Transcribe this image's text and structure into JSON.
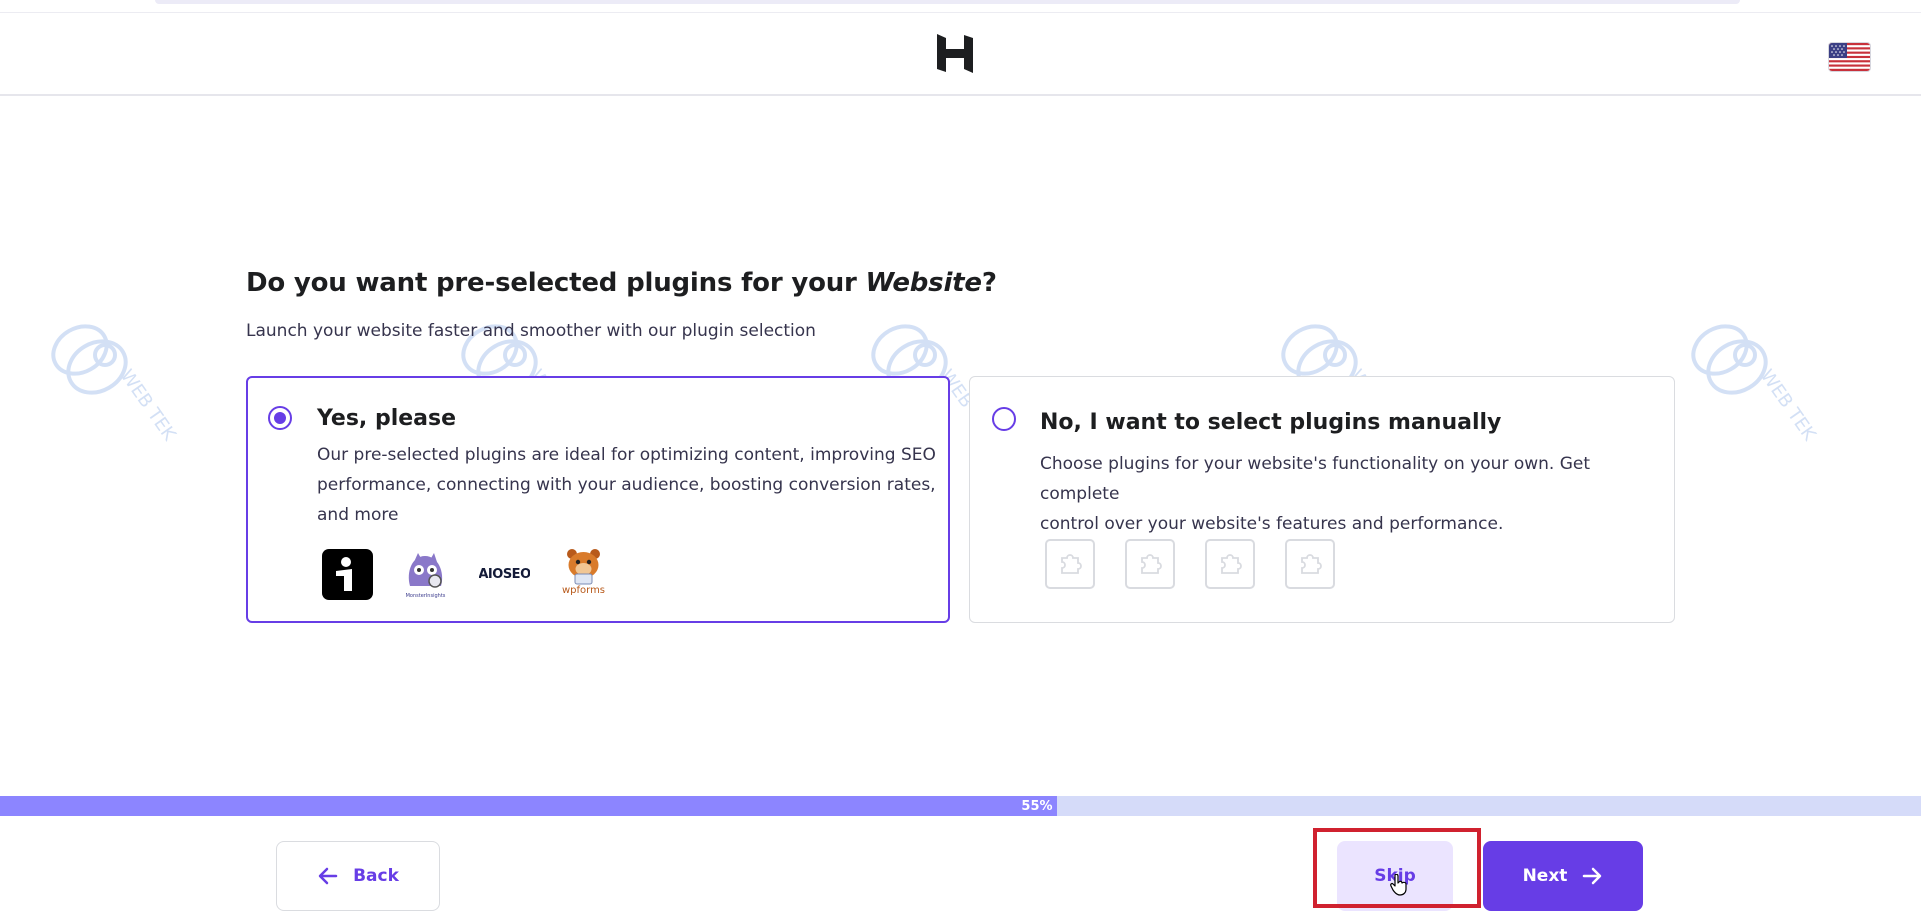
{
  "header": {
    "logo_icon": "hostinger-logo-icon",
    "language_flag_icon": "us-flag-icon"
  },
  "watermark": {
    "text": "WEB TEK"
  },
  "question": {
    "prefix": "Do you want pre-selected plugins for your ",
    "emphasis": "Website",
    "suffix": "?"
  },
  "subtitle": "Launch your website faster and smoother with our plugin selection",
  "options": [
    {
      "title": "Yes, please",
      "description_lines": [
        "Our pre-selected plugins are ideal for optimizing content, improving SEO",
        "performance, connecting with your audience, boosting conversion rates,",
        "and more"
      ],
      "selected": true,
      "plugin_icons": [
        "jetpack-info-icon",
        "monsterinsights-icon",
        "aioseo-icon",
        "wpforms-icon"
      ],
      "plugin_labels": {
        "monsterinsights": "MonsterInsights",
        "aioseo": "AIOSEO",
        "wpforms": "wpforms"
      }
    },
    {
      "title": "No, I want to select plugins manually",
      "description_lines": [
        "Choose plugins for your website's functionality on your own. Get complete",
        "control over your website's features and performance."
      ],
      "selected": false,
      "placeholder_icons": [
        "puzzle-icon",
        "puzzle-icon",
        "puzzle-icon",
        "puzzle-icon"
      ]
    }
  ],
  "progress": {
    "value": 0.55,
    "label": "55%"
  },
  "footer": {
    "back_label": "Back",
    "skip_label": "Skip",
    "next_label": "Next"
  },
  "colors": {
    "accent": "#673de6",
    "progress_fill": "#8c85ff",
    "progress_track": "#d5dbf9",
    "skip_bg": "#ebe4ff",
    "highlight": "#d0212f"
  }
}
